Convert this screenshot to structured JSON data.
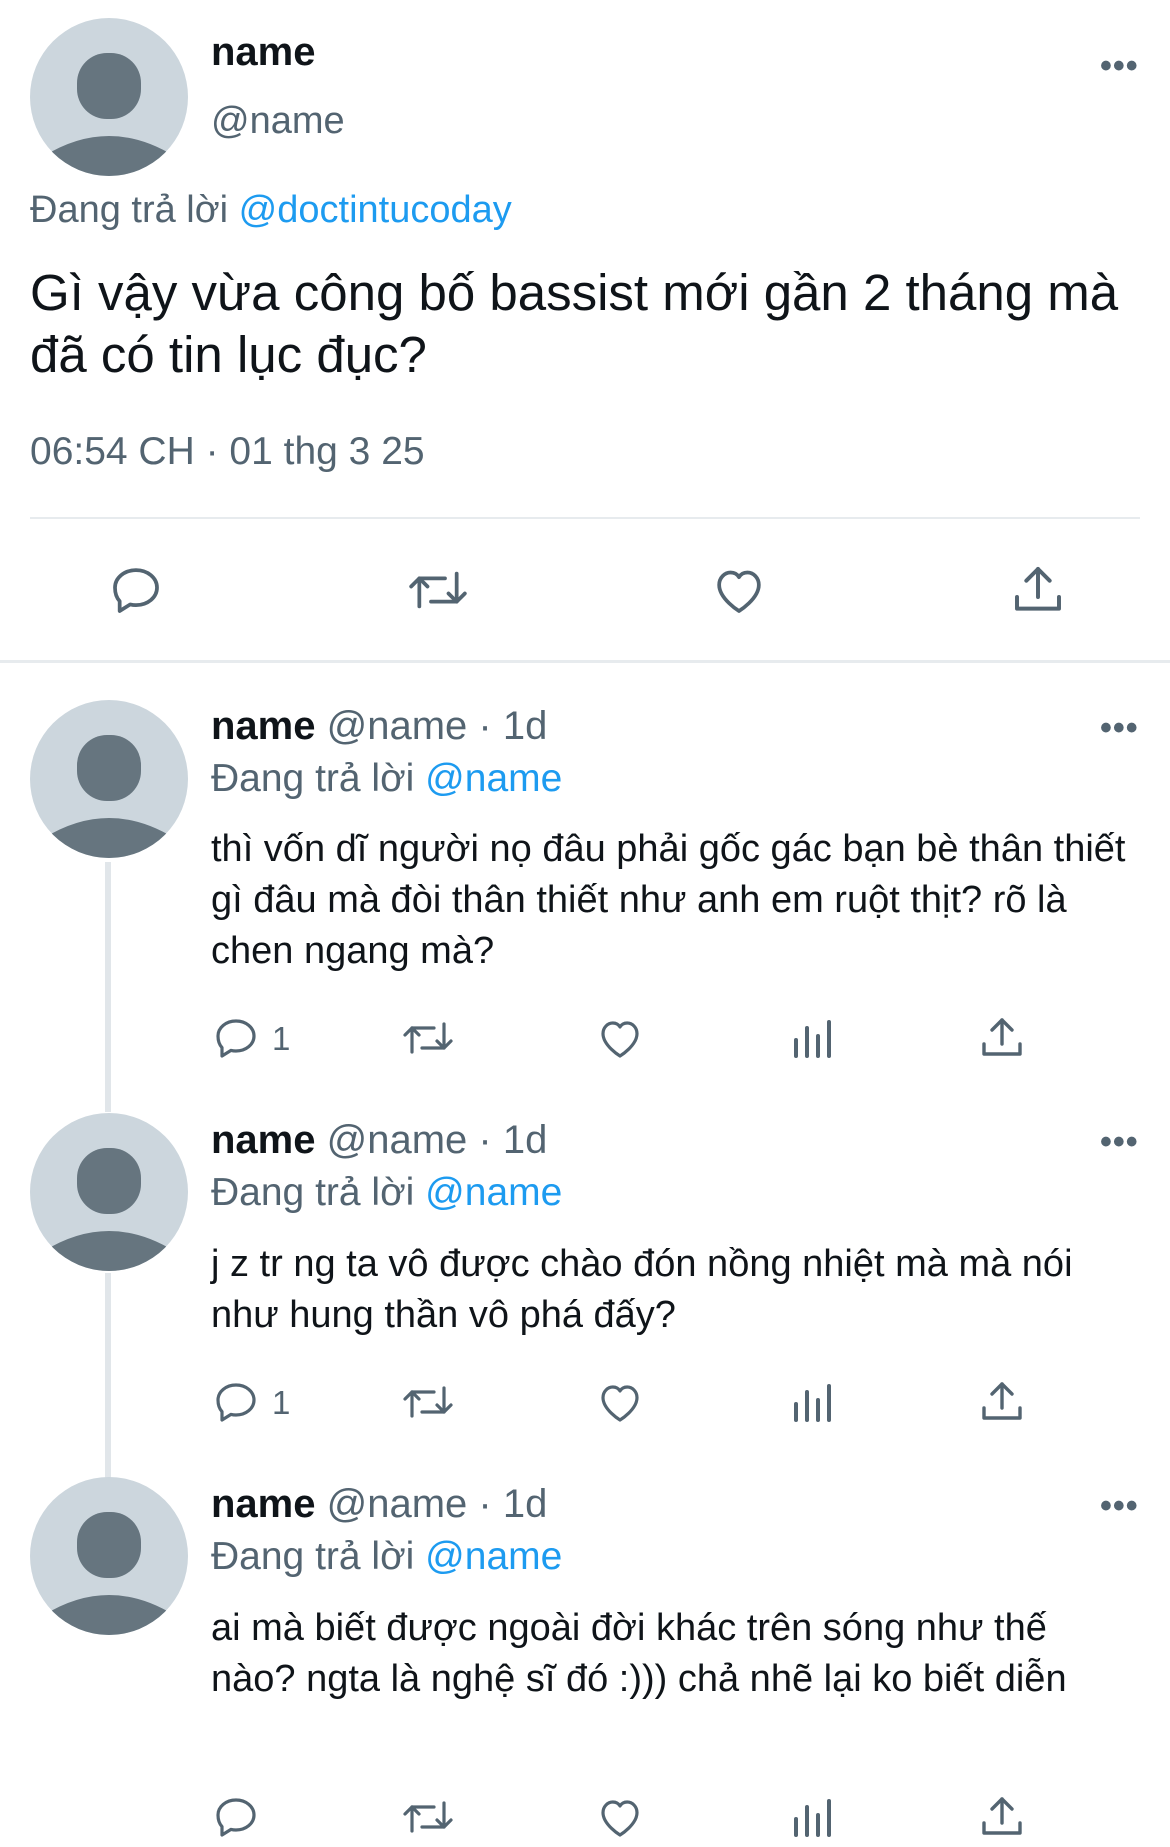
{
  "main_tweet": {
    "name": "name",
    "handle": "@name",
    "replying_to_prefix": "Đang trả lời",
    "replying_to_handle": "@doctintucoday",
    "text": "Gì vậy vừa công bố bassist mới gần 2 tháng mà đã có tin lục đục?",
    "timestamp": "06:54 CH · 01 thg 3 25",
    "actions": [
      "reply-icon",
      "retweet-icon",
      "like-icon",
      "share-icon"
    ]
  },
  "replies": [
    {
      "name": "name",
      "handle_time": "@name · 1d",
      "replying_to_prefix": "Đang trả lời",
      "replying_to_handle": "@name",
      "text": "thì vốn dĩ người nọ đâu phải gốc gác bạn bè thân thiết gì đâu mà đòi thân thiết như anh em ruột thịt? rõ là chen ngang mà?",
      "reply_count": "1"
    },
    {
      "name": "name",
      "handle_time": "@name · 1d",
      "replying_to_prefix": "Đang trả lời",
      "replying_to_handle": "@name",
      "text": "j z tr ng ta vô được chào đón nồng nhiệt mà mà nói như hung thần vô phá đấy?",
      "reply_count": "1"
    },
    {
      "name": "name",
      "handle_time": "@name · 1d",
      "replying_to_prefix": "Đang trả lời",
      "replying_to_handle": "@name",
      "text": "ai mà biết được ngoài đời khác trên sóng như thế nào? ngta là nghệ sĩ đó :))) chả nhẽ lại ko biết diễn",
      "reply_count": ""
    }
  ],
  "more_icon_glyph": "•••",
  "colors": {
    "link": "#1d9bf0",
    "muted": "#536471",
    "avatar_bg": "#ccd6dd",
    "avatar_fg": "#66757f"
  }
}
